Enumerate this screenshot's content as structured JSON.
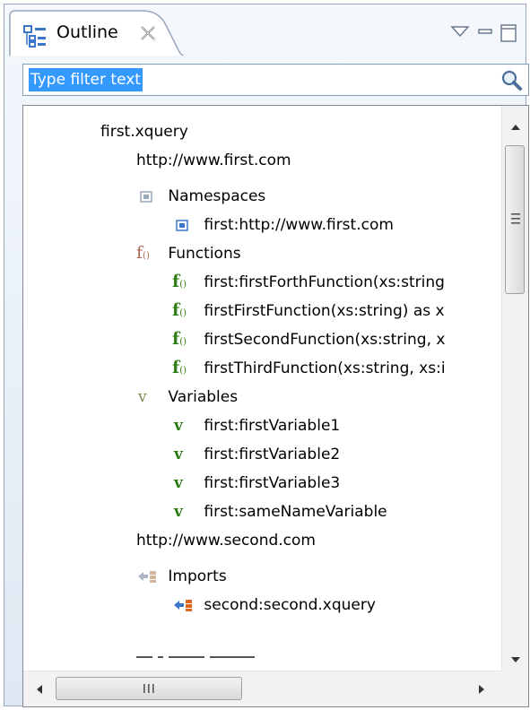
{
  "view": {
    "title": "Outline",
    "icons": {
      "outline": "outline-view-icon",
      "close": "close-x-icon",
      "menu": "view-menu-triangle-icon",
      "minimize": "minimize-icon",
      "maximize": "maximize-icon"
    }
  },
  "filter": {
    "value": "Type filter text",
    "icon": "search-magnifier-icon"
  },
  "tree": [
    {
      "label": "first.xquery",
      "icon": "none"
    },
    {
      "label": "http://www.first.com",
      "icon": "none"
    },
    {
      "label": "Namespaces",
      "icon": "namespace-folder-icon"
    },
    {
      "label": "first:http://www.first.com",
      "icon": "namespace-icon"
    },
    {
      "label": "Functions",
      "icon": "functions-folder-icon"
    },
    {
      "label": "first:firstForthFunction(xs:string",
      "icon": "function-icon"
    },
    {
      "label": "firstFirstFunction(xs:string) as x",
      "icon": "function-icon"
    },
    {
      "label": "firstSecondFunction(xs:string, x",
      "icon": "function-icon"
    },
    {
      "label": "firstThirdFunction(xs:string, xs:i",
      "icon": "function-icon"
    },
    {
      "label": "Variables",
      "icon": "variables-folder-icon"
    },
    {
      "label": "first:firstVariable1",
      "icon": "variable-icon"
    },
    {
      "label": "first:firstVariable2",
      "icon": "variable-icon"
    },
    {
      "label": "first:firstVariable3",
      "icon": "variable-icon"
    },
    {
      "label": "first:sameNameVariable",
      "icon": "variable-icon"
    },
    {
      "label": "http://www.second.com",
      "icon": "none"
    },
    {
      "label": "Imports",
      "icon": "imports-folder-icon"
    },
    {
      "label": "second:second.xquery",
      "icon": "import-icon"
    }
  ],
  "scroll": {
    "vertical_position": 0.0,
    "horizontal_position": 0.0,
    "h_grip": "III"
  },
  "colors": {
    "selection": "#3399ff",
    "function_green": "#2e7d14",
    "function_faded": "#a76753",
    "namespace_blue": "#3c76c8"
  }
}
